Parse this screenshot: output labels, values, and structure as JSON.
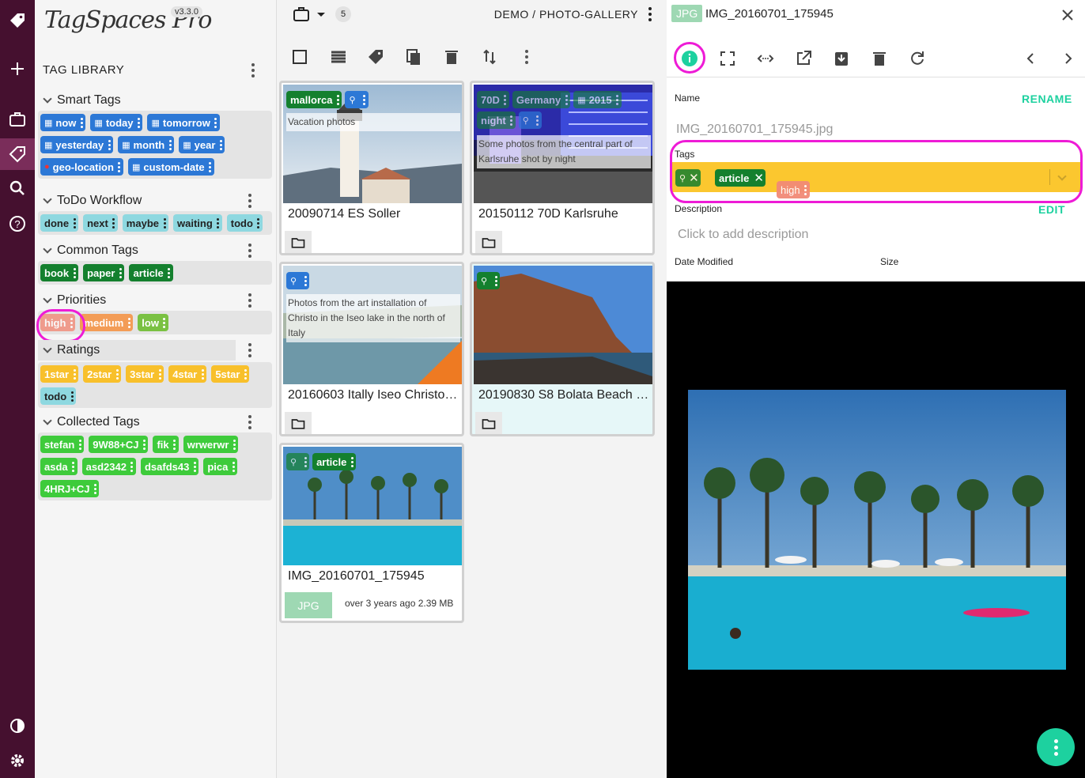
{
  "app": {
    "name": "TagSpaces Pro",
    "version": "v3.3.0"
  },
  "library": {
    "title": "TAG LIBRARY",
    "groups": [
      {
        "name": "Smart Tags",
        "color": "#2c78d6",
        "tags": [
          "now",
          "today",
          "tomorrow",
          "yesterday",
          "month",
          "year",
          "geo-location",
          "custom-date"
        ]
      },
      {
        "name": "ToDo Workflow",
        "color": "#8ed8e0",
        "tags": [
          "done",
          "next",
          "maybe",
          "waiting",
          "todo"
        ]
      },
      {
        "name": "Common Tags",
        "color": "#14802e",
        "tags": [
          "book",
          "paper",
          "article"
        ]
      },
      {
        "name": "Priorities",
        "tags": [
          "high",
          "medium",
          "low"
        ],
        "colors": [
          "#f28a77",
          "#f39c56",
          "#7ac142"
        ]
      },
      {
        "name": "Ratings",
        "color": "#f8c02b",
        "tags": [
          "1star",
          "2star",
          "3star",
          "4star",
          "5star",
          "todo"
        ]
      },
      {
        "name": "Collected Tags",
        "color": "#3ecb3b",
        "tags": [
          "stefan",
          "9W88+CJ",
          "fik",
          "wrwerwr",
          "asda",
          "asd2342",
          "dsafds43",
          "pica",
          "4HRJ+CJ"
        ]
      }
    ]
  },
  "grid": {
    "count": "5",
    "breadcrumb": "DEMO /  PHOTO-GALLERY",
    "files": [
      {
        "name": "20090714 ES Soller",
        "tags": [
          "mallorca"
        ],
        "description": "Vacation photos"
      },
      {
        "name": "20150112 70D Karlsruhe",
        "tags": [
          "70D",
          "Germany",
          "2015",
          "night"
        ],
        "description": "Some photos from the central part of Karlsruhe shot by night"
      },
      {
        "name": "20160603 Itally Iseo Christo…",
        "tags": [],
        "description": "Photos from the art installation of Christo in the Iseo lake in the north of Italy"
      },
      {
        "name": "20190830 S8 Bolata Beach …",
        "tags": [],
        "description": ""
      },
      {
        "name": "IMG_20160701_175945",
        "tags": [
          "article"
        ],
        "description": "",
        "type": "JPG",
        "modified": "over 3 years ago",
        "size": "2.39 MB"
      }
    ]
  },
  "properties": {
    "file_type": "JPG",
    "title": "IMG_20160701_175945",
    "name_label": "Name",
    "rename_label": "RENAME",
    "filename": "IMG_20160701_175945.jpg",
    "tags_label": "Tags",
    "tags": [
      "article"
    ],
    "dragged_tag": "high",
    "description_label": "Description",
    "edit_label": "EDIT",
    "description_placeholder": "Click to add description",
    "date_modified_label": "Date Modified",
    "size_label": "Size"
  },
  "colors": {
    "accent": "#1dd19f",
    "rail": "#45102f",
    "highlight_ring": "#ee1bd6",
    "tags_field": "#fbc72f"
  }
}
